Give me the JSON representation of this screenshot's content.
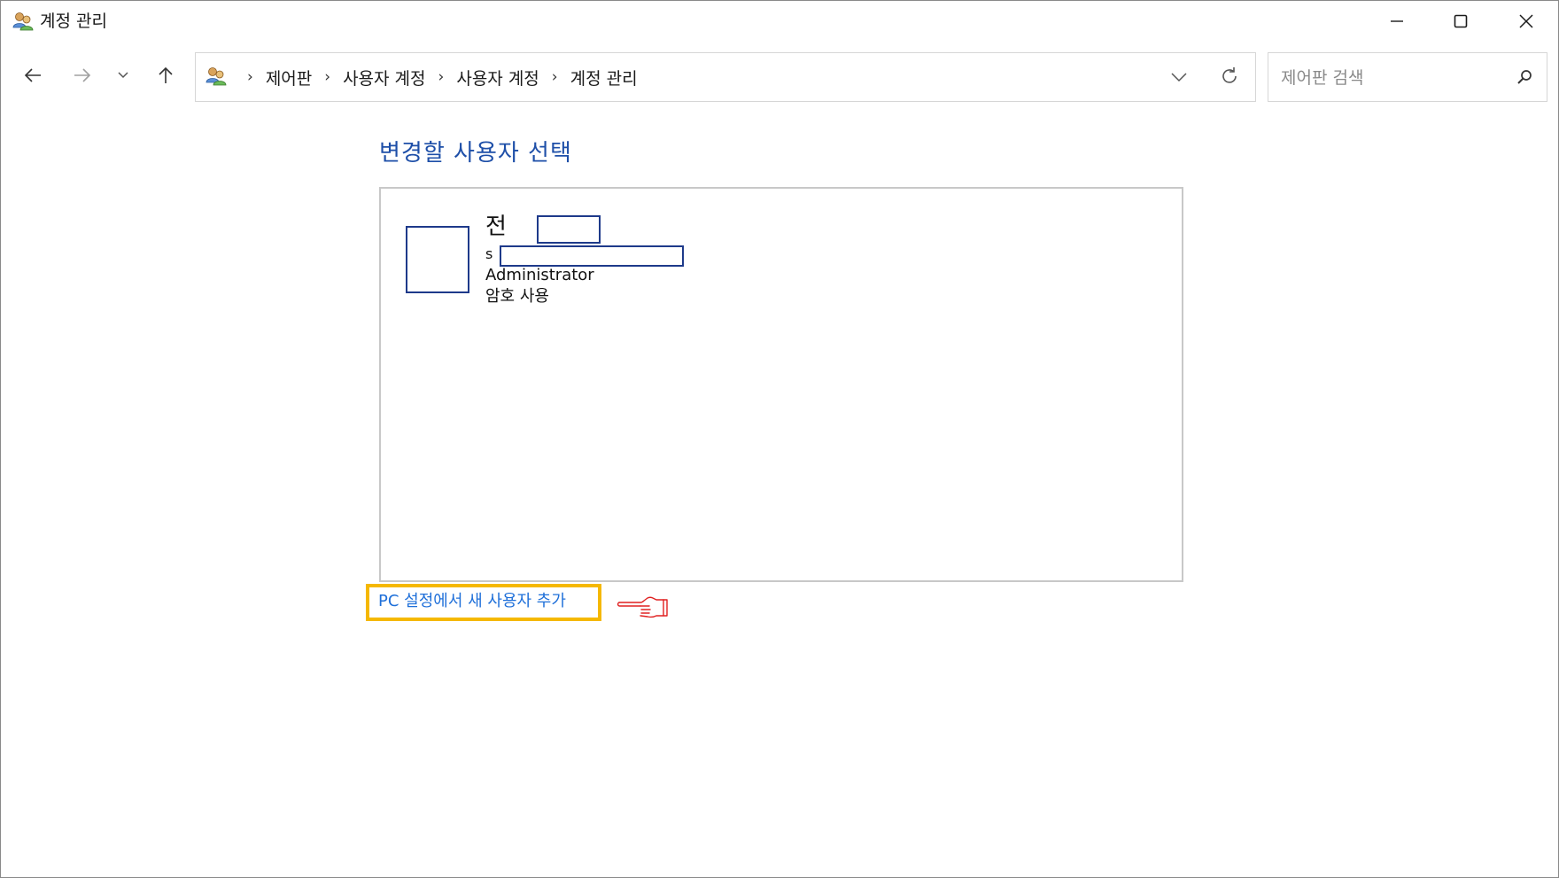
{
  "window": {
    "title": "계정 관리"
  },
  "address": {
    "crumbs": [
      "제어판",
      "사용자 계정",
      "사용자 계정",
      "계정 관리"
    ]
  },
  "search": {
    "placeholder": "제어판 검색"
  },
  "main": {
    "heading": "변경할 사용자 선택",
    "user": {
      "name": "전",
      "email": "s",
      "role": "Administrator",
      "status": "암호 사용"
    },
    "add_user_link": "PC 설정에서 새 사용자 추가"
  },
  "colors": {
    "heading": "#1e4fa8",
    "link": "#1e6fd9",
    "highlight_box": "#f5b800",
    "redaction": "#1e3a8a",
    "pointer_hand": "#e02020"
  },
  "icons": {
    "window": "users-icon",
    "nav_back": "arrow-left-icon",
    "nav_forward": "arrow-right-icon",
    "recent": "chevron-down-icon",
    "up": "arrow-up-icon",
    "refresh": "refresh-icon",
    "search": "search-icon",
    "annotation": "pointing-hand-icon"
  }
}
